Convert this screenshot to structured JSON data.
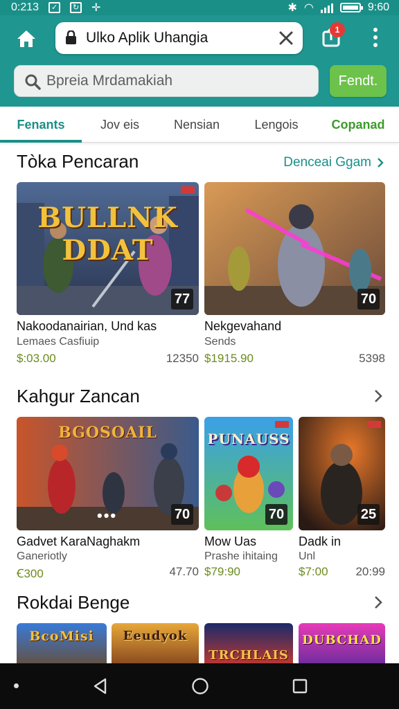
{
  "status_bar": {
    "time_left": "0:213",
    "time_right": "9:60"
  },
  "browser": {
    "url_text": "Ulko Aplik Uhangia",
    "notification_count": "1"
  },
  "search": {
    "placeholder": "Bpreia Mrdamakiah",
    "button_label": "Fendt."
  },
  "tabs": [
    {
      "label": "Fenants",
      "active": true
    },
    {
      "label": "Jov eis"
    },
    {
      "label": "Nensian"
    },
    {
      "label": "Lengois"
    },
    {
      "label": "Copanad"
    }
  ],
  "sections": [
    {
      "title": "Tòka Pencaran",
      "see_all": "Denceai Ggam",
      "cards": [
        {
          "thumb_title": "BULLNK DDAT",
          "rating": "77",
          "name": "Nakoodanairian, Und kas",
          "developer": "Lemaes Casfiuip",
          "price": "$:03.00",
          "count": "12350"
        },
        {
          "thumb_title": "",
          "rating": "70",
          "name": "Nekgevahand",
          "developer": "Sends",
          "price": "$1915.90",
          "count": "5398"
        }
      ]
    },
    {
      "title": "Kahgur Zancan",
      "cards": [
        {
          "thumb_title": "BGOSOAIL",
          "rating": "70",
          "name": "Gadvet KaraNaghakm",
          "developer": "Ganeriotly",
          "price": "Ꞓ300",
          "count": "47.70"
        },
        {
          "thumb_title": "PUNAUSS",
          "rating": "70",
          "name": "Mow Uas",
          "developer": "Prashe ihitaing",
          "price": "$79:90",
          "count": ""
        },
        {
          "thumb_title": "",
          "rating": "25",
          "name": "Dadk in",
          "developer": "Unl",
          "price": "$7:00",
          "count": "20:99"
        }
      ]
    },
    {
      "title": "Rokdai Benge",
      "cards": [
        {
          "thumb_title": "BcoMisi"
        },
        {
          "thumb_title": "Eeudyok"
        },
        {
          "thumb_title": "TRCHLAIS"
        },
        {
          "thumb_title": "DUBCHAD"
        }
      ]
    }
  ],
  "colors": {
    "header_teal": "#1f9690",
    "accent_green": "#6cc24a",
    "price_green": "#6b8b1e",
    "tab_active": "#1a8f88"
  },
  "icons": [
    "home-icon",
    "lock-icon",
    "close-icon",
    "share-icon",
    "menu-icon",
    "search-icon",
    "chevron-right-icon",
    "nav-back-icon",
    "nav-home-icon",
    "nav-recent-icon"
  ]
}
